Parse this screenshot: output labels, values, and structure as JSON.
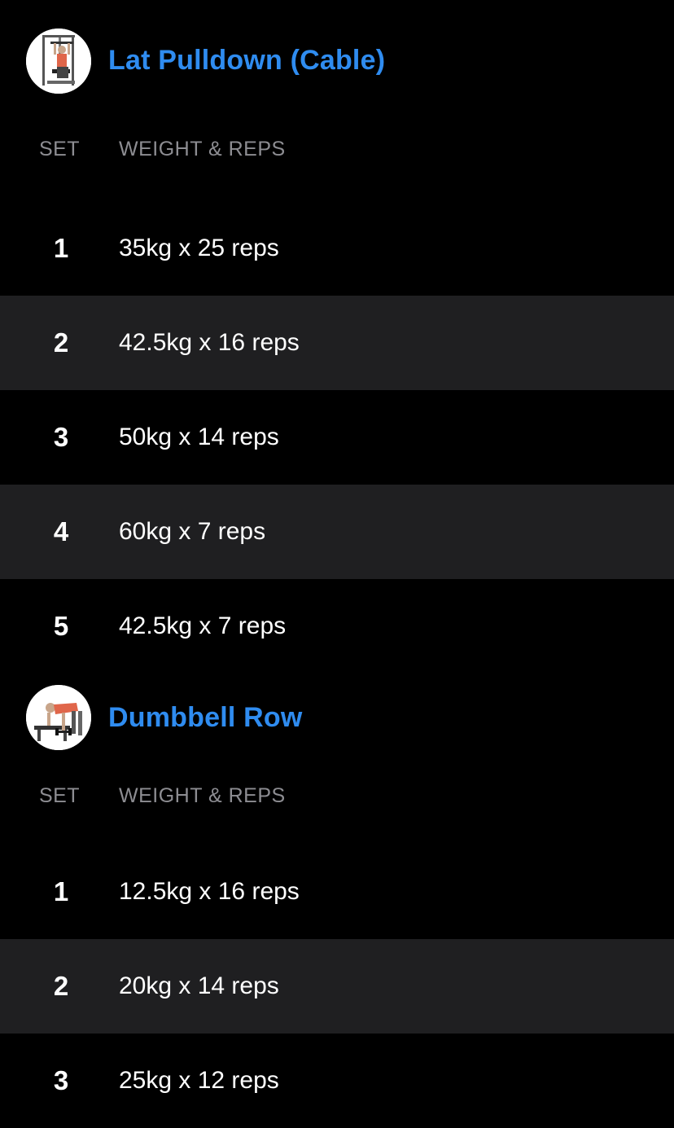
{
  "colors": {
    "background": "#000000",
    "title_blue": "#2f8cf0",
    "header_gray": "#8d8d92",
    "alt_row": "#1f1f21"
  },
  "exercises": [
    {
      "title": "Lat Pulldown (Cable)",
      "thumbnail_icon": "lat-pulldown-machine-icon",
      "col_set": "SET",
      "col_weight": "WEIGHT & REPS",
      "sets": [
        {
          "num": "1",
          "value": "35kg x 25 reps"
        },
        {
          "num": "2",
          "value": "42.5kg x 16 reps"
        },
        {
          "num": "3",
          "value": "50kg x 14 reps"
        },
        {
          "num": "4",
          "value": "60kg x 7 reps"
        },
        {
          "num": "5",
          "value": "42.5kg x 7 reps"
        }
      ]
    },
    {
      "title": "Dumbbell Row",
      "thumbnail_icon": "dumbbell-row-icon",
      "col_set": "SET",
      "col_weight": "WEIGHT & REPS",
      "sets": [
        {
          "num": "1",
          "value": "12.5kg x 16 reps"
        },
        {
          "num": "2",
          "value": "20kg x 14 reps"
        },
        {
          "num": "3",
          "value": "25kg x 12 reps"
        }
      ]
    }
  ]
}
